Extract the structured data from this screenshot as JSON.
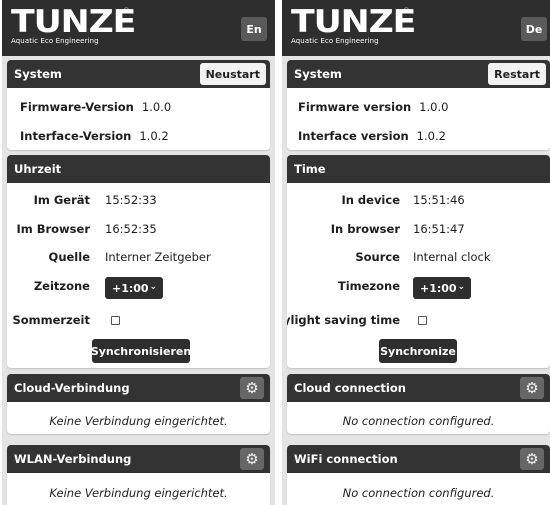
{
  "logo": {
    "brand": "TUNZE",
    "tagline": "Aquatic Eco Engineering",
    "mark": "®"
  },
  "panels": {
    "de": {
      "lang_button": "En",
      "system": {
        "title": "System",
        "restart_label": "Neustart",
        "firmware_label": "Firmware-Version",
        "firmware_value": "1.0.0",
        "interface_label": "Interface-Version",
        "interface_value": "1.0.2"
      },
      "time": {
        "title": "Uhrzeit",
        "device_label": "Im Gerät",
        "device_value": "15:52:33",
        "browser_label": "Im Browser",
        "browser_value": "16:52:35",
        "source_label": "Quelle",
        "source_value": "Interner Zeitgeber",
        "timezone_label": "Zeitzone",
        "timezone_value": "+1:00",
        "dst_label": "Sommerzeit",
        "sync_label": "Synchronisieren"
      },
      "cloud": {
        "title": "Cloud-Verbindung",
        "status": "Keine Verbindung eingerichtet."
      },
      "wifi": {
        "title": "WLAN-Verbindung",
        "status": "Keine Verbindung eingerichtet."
      }
    },
    "en": {
      "lang_button": "De",
      "system": {
        "title": "System",
        "restart_label": "Restart",
        "firmware_label": "Firmware version",
        "firmware_value": "1.0.0",
        "interface_label": "Interface version",
        "interface_value": "1.0.2"
      },
      "time": {
        "title": "Time",
        "device_label": "In device",
        "device_value": "15:51:46",
        "browser_label": "In browser",
        "browser_value": "16:51:47",
        "source_label": "Source",
        "source_value": "Internal clock",
        "timezone_label": "Timezone",
        "timezone_value": "+1:00",
        "dst_label": "Daylight saving time",
        "sync_label": "Synchronize"
      },
      "cloud": {
        "title": "Cloud connection",
        "status": "No connection configured."
      },
      "wifi": {
        "title": "WiFi connection",
        "status": "No connection configured."
      }
    }
  },
  "icons": {
    "gear": "gear-icon",
    "chevron": "chevron-down-icon",
    "checkbox": "checkbox-icon"
  },
  "colors": {
    "header": "#2e2e2e",
    "card_head": "#333333",
    "background": "#e4e4e4",
    "gear_button": "#666666"
  }
}
